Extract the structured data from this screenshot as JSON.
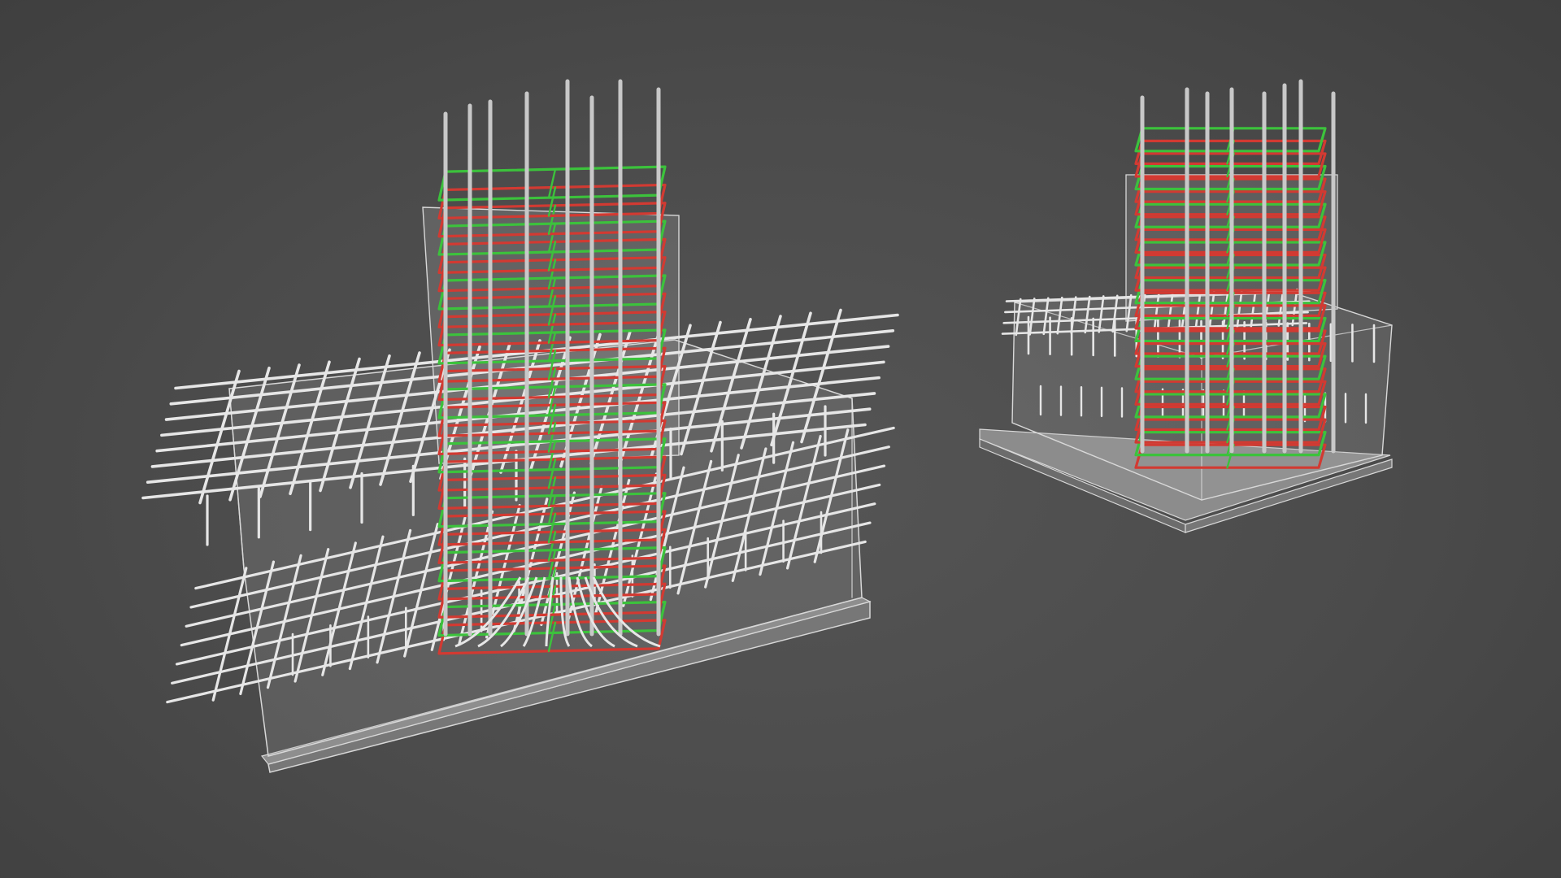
{
  "scene": {
    "background_color": "#4a4a4a",
    "concrete_outline_color": "#d8d8d8",
    "concrete_fill_color": "#8a8a8a",
    "mesh_rebar_color": "#e6e6e6",
    "vertical_rebar_color": "#c8c8c8",
    "stirrup_colors": [
      "#d23a32",
      "#3cc23c"
    ],
    "models": [
      {
        "name": "footing-large",
        "stirrup_count": 26
      },
      {
        "name": "footing-small",
        "stirrup_count": 26
      }
    ]
  }
}
